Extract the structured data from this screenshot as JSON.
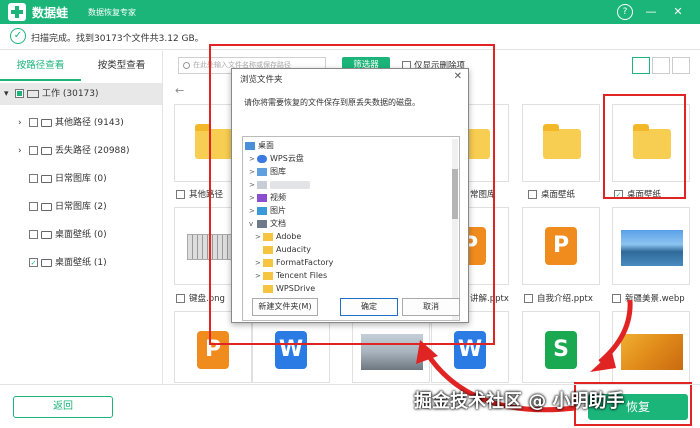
{
  "app": {
    "name": "数据蛙",
    "subtitle": "数据恢复专家",
    "help": "?",
    "minimize": "—",
    "close": "✕"
  },
  "status": {
    "text": "扫描完成。找到30173个文件共3.12 GB。"
  },
  "tabs": [
    {
      "label": "按路径查看",
      "active": true
    },
    {
      "label": "按类型查看",
      "active": false
    }
  ],
  "tree": {
    "root": "工作 (30173)",
    "items": [
      {
        "label": "其他路径 (9143)",
        "expandable": true,
        "checked": false
      },
      {
        "label": "丢失路径 (20988)",
        "expandable": true,
        "checked": false
      },
      {
        "label": "日常图库 (0)",
        "expandable": false,
        "checked": false
      },
      {
        "label": "日常图库 (2)",
        "expandable": false,
        "checked": false
      },
      {
        "label": "桌面壁纸 (0)",
        "expandable": false,
        "checked": false
      },
      {
        "label": "桌面壁纸 (1)",
        "expandable": false,
        "checked": true
      }
    ]
  },
  "toolbar": {
    "search_placeholder": "在此处输入文件名称或保存路径",
    "filter_label": "筛选器",
    "only_deleted": "仅显示删除项"
  },
  "nav": {
    "back_arrow": "←"
  },
  "files": {
    "row1": [
      {
        "label": "其他路径"
      },
      {
        "label": "常图库"
      },
      {
        "label": "桌面壁纸"
      },
      {
        "label": "桌面壁纸"
      }
    ],
    "row2": [
      {
        "label": "键盘.png"
      },
      {
        "label": "讲解.pptx"
      },
      {
        "label": "自我介绍.pptx"
      },
      {
        "label": "新疆美景.webp"
      }
    ]
  },
  "dialog": {
    "title": "浏览文件夹",
    "close": "✕",
    "message": "请你将需要恢复的文件保存到原丢失数据的磁盘。",
    "tree": [
      {
        "label": "桌面",
        "indent": 0,
        "arrow": "",
        "icon": "desktop"
      },
      {
        "label": "WPS云盘",
        "indent": 1,
        "arrow": ">",
        "icon": "cloud"
      },
      {
        "label": "图库",
        "indent": 1,
        "arrow": ">",
        "icon": "gallery"
      },
      {
        "label": "",
        "indent": 1,
        "arrow": ">",
        "icon": "user"
      },
      {
        "label": "视频",
        "indent": 1,
        "arrow": ">",
        "icon": "video"
      },
      {
        "label": "图片",
        "indent": 1,
        "arrow": ">",
        "icon": "image"
      },
      {
        "label": "文档",
        "indent": 1,
        "arrow": "v",
        "icon": "doc"
      },
      {
        "label": "Adobe",
        "indent": 2,
        "arrow": ">",
        "icon": "folder"
      },
      {
        "label": "Audacity",
        "indent": 2,
        "arrow": "",
        "icon": "folder"
      },
      {
        "label": "FormatFactory",
        "indent": 2,
        "arrow": ">",
        "icon": "folder"
      },
      {
        "label": "Tencent Files",
        "indent": 2,
        "arrow": ">",
        "icon": "folder"
      },
      {
        "label": "WPSDrive",
        "indent": 2,
        "arrow": "",
        "icon": "folder"
      }
    ],
    "new_folder": "新建文件夹(M)",
    "ok": "确定",
    "cancel": "取消"
  },
  "bottom": {
    "back_label": "返回",
    "recover_label": "恢复"
  },
  "watermark": "掘金技术社区 @ 小明助手",
  "colors": {
    "accent": "#1bb57a",
    "annotation": "#e02424"
  }
}
